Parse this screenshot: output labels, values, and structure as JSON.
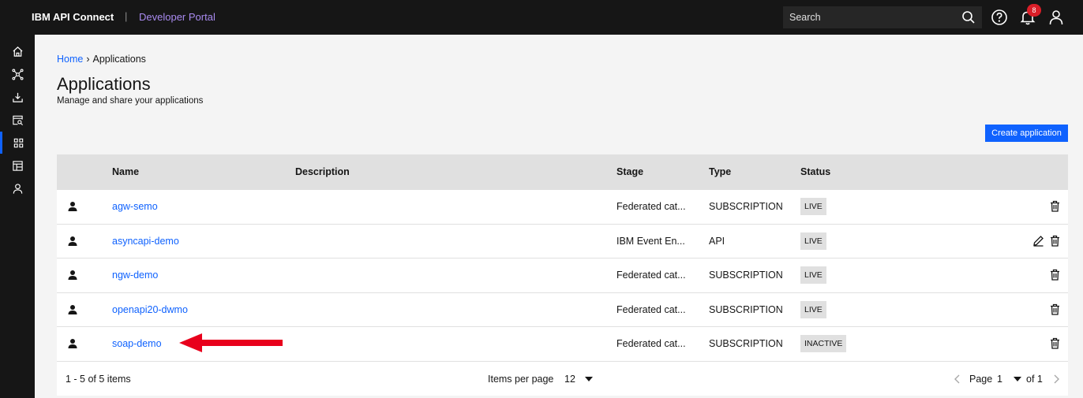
{
  "header": {
    "brand": "IBM API Connect",
    "separator": "|",
    "portal": "Developer Portal",
    "search_placeholder": "Search",
    "notifications_count": "8"
  },
  "rail": {
    "items": [
      "home-icon",
      "apis-icon",
      "download-icon",
      "catalog-search-icon",
      "apps-grid-icon",
      "dashboard-icon",
      "user-icon"
    ],
    "active_index": 4
  },
  "breadcrumb": {
    "home": "Home",
    "current": "Applications"
  },
  "page": {
    "title": "Applications",
    "subtitle": "Manage and share your applications",
    "create_label": "Create application"
  },
  "table": {
    "headers": {
      "name": "Name",
      "description": "Description",
      "stage": "Stage",
      "type": "Type",
      "status": "Status"
    },
    "rows": [
      {
        "name": "agw-semo",
        "description": "",
        "stage": "Federated cat...",
        "type": "SUBSCRIPTION",
        "status": "LIVE",
        "editable": false
      },
      {
        "name": "asyncapi-demo",
        "description": "",
        "stage": "IBM Event En...",
        "type": "API",
        "status": "LIVE",
        "editable": true
      },
      {
        "name": "ngw-demo",
        "description": "",
        "stage": "Federated cat...",
        "type": "SUBSCRIPTION",
        "status": "LIVE",
        "editable": false
      },
      {
        "name": "openapi20-dwmo",
        "description": "",
        "stage": "Federated cat...",
        "type": "SUBSCRIPTION",
        "status": "LIVE",
        "editable": false
      },
      {
        "name": "soap-demo",
        "description": "",
        "stage": "Federated cat...",
        "type": "SUBSCRIPTION",
        "status": "INACTIVE",
        "editable": false
      }
    ]
  },
  "pagination": {
    "range": "1 - 5 of 5 items",
    "items_per_page_label": "Items per page",
    "items_per_page": "12",
    "page_label": "Page",
    "page": "1",
    "of_pages": "of 1"
  },
  "colors": {
    "accent": "#0f62fe",
    "header_bg": "#161616",
    "annotation_arrow": "#e8001c",
    "badge": "#da1e28"
  }
}
